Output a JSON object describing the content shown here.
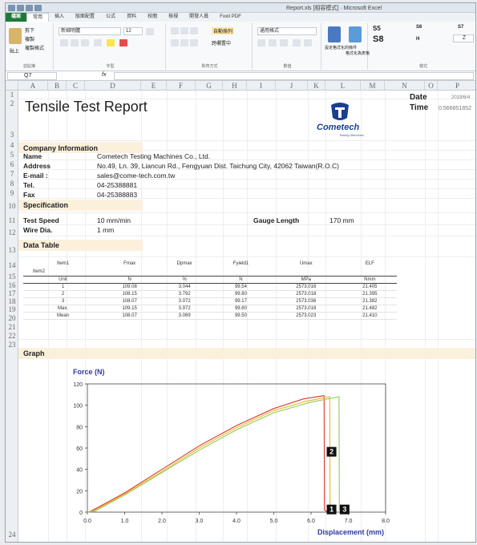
{
  "window": {
    "document_title": "Report.xls  [相容模式]  ·  Microsoft Excel"
  },
  "ribbon": {
    "tabs": [
      {
        "label": "檔案"
      },
      {
        "label": "常用"
      },
      {
        "label": "插入"
      },
      {
        "label": "版面配置"
      },
      {
        "label": "公式"
      },
      {
        "label": "資料"
      },
      {
        "label": "校閱"
      },
      {
        "label": "檢視"
      },
      {
        "label": "開發人員"
      },
      {
        "label": "Foxit PDF"
      }
    ],
    "clipboard": {
      "paste": "貼上",
      "cut": "剪下",
      "copy": "複製",
      "format_painter": "複製格式",
      "label": "剪貼簿"
    },
    "font": {
      "name": "新細明體",
      "size": "12",
      "label": "字型"
    },
    "alignment": {
      "wrap": "自動換列",
      "merge": "跨欄置中",
      "label": "對齊方式"
    },
    "number": {
      "format": "通用格式",
      "label": "數值"
    },
    "conditional": {
      "cond_fmt": "設定格式化的條件",
      "table_fmt": "格式化為表格"
    },
    "styles": {
      "s5": "S5",
      "s6": "S6",
      "s7": "S7",
      "s8": "S8",
      "label": "樣式"
    },
    "style_extra": {
      "h": "H",
      "z": "Z"
    }
  },
  "formula_bar": {
    "name_box": "Q7",
    "fx": "fx",
    "value": ""
  },
  "columns": [
    "A",
    "B",
    "C",
    "D",
    "E",
    "F",
    "G",
    "H",
    "I",
    "J",
    "K",
    "L",
    "M",
    "N",
    "O",
    "P"
  ],
  "rows": [
    "1",
    "2",
    "3",
    "4",
    "5",
    "6",
    "7",
    "8",
    "9",
    "10",
    "11",
    "12",
    "13",
    "14",
    "15",
    "16",
    "17",
    "18",
    "19",
    "20",
    "21",
    "22",
    "23",
    "24"
  ],
  "report": {
    "title": "Tensile Test Report",
    "date_label": "Date",
    "date_value": "2019/6/4",
    "time_label": "Time",
    "time_value": "0.566851852"
  },
  "logo": {
    "name": "Cometech",
    "tagline": "Testing Machines"
  },
  "company": {
    "heading": "Company Information",
    "fields": [
      {
        "label": "Name",
        "value": "Cometech Testing Machines Co., Ltd."
      },
      {
        "label": "Address",
        "value": "No.49, Ln. 39, Liancun Rd., Fengyuan Dist. Taichung City, 42062 Taiwan(R.O.C)"
      },
      {
        "label": "E-mail :",
        "value": "sales@come-tech.com.tw"
      },
      {
        "label": "Tel.",
        "value": "04-25388881"
      },
      {
        "label": "Fax",
        "value": "04-25388883"
      }
    ]
  },
  "specification": {
    "heading": "Specification",
    "test_speed_label": "Test Speed",
    "test_speed_value": "10 mm/min",
    "gauge_label": "Gauge Length",
    "gauge_value": "170 mm",
    "wire_label": "Wire Dia.",
    "wire_value": "1 mm"
  },
  "data_table": {
    "heading": "Data Table",
    "headers": [
      "Item1",
      "Fmax",
      "Dpmax",
      "Fyield1",
      "Umax",
      "ELF"
    ],
    "item2": "Item2",
    "units": [
      "Unit",
      "N",
      "%",
      "N",
      "MPa",
      "Nmm"
    ],
    "rows": [
      [
        "1",
        "109.08",
        "3.044",
        "99.54",
        "2573.016",
        "21.405"
      ],
      [
        "2",
        "108.15",
        "3.792",
        "99.80",
        "2573.018",
        "21.395"
      ],
      [
        "3",
        "108.07",
        "3.072",
        "99.17",
        "2573.036",
        "21.382"
      ],
      [
        "Max.",
        "109.15",
        "3.972",
        "99.80",
        "2573.018",
        "21.482"
      ],
      [
        "Mean",
        "108.07",
        "3.069",
        "99.50",
        "2573.023",
        "21.410"
      ]
    ]
  },
  "graph": {
    "heading": "Graph"
  },
  "chart_data": {
    "type": "line",
    "title": "",
    "xlabel": "Displacement (mm)",
    "ylabel": "Force (N)",
    "xlim": [
      0,
      8
    ],
    "ylim": [
      0,
      120
    ],
    "xticks": [
      "0.0",
      "1.0",
      "2.0",
      "3.0",
      "4.0",
      "5.0",
      "6.0",
      "7.0",
      "8.0"
    ],
    "yticks": [
      "0",
      "20",
      "40",
      "60",
      "80",
      "100",
      "120"
    ],
    "grid": false,
    "series": [
      {
        "color": "#d9362c",
        "x": [
          0,
          0.1,
          1.0,
          2.0,
          3.0,
          4.0,
          5.0,
          5.8,
          6.35,
          6.36,
          6.45
        ],
        "y": [
          0,
          1,
          18,
          40,
          62,
          81,
          97,
          106,
          109,
          2,
          0
        ]
      },
      {
        "color": "#e5b81e",
        "x": [
          0,
          0.15,
          1.0,
          2.0,
          3.0,
          4.0,
          5.0,
          5.9,
          6.5,
          6.51,
          6.6
        ],
        "y": [
          0,
          1,
          17,
          38,
          60,
          79,
          95,
          104,
          108,
          2,
          0
        ]
      },
      {
        "color": "#95c95a",
        "x": [
          0,
          0.2,
          1.0,
          2.0,
          3.0,
          4.0,
          5.0,
          6.0,
          6.75,
          6.76,
          6.85
        ],
        "y": [
          0,
          1,
          16,
          37,
          58,
          77,
          93,
          103,
          108,
          2,
          0
        ]
      }
    ],
    "annotations": [
      {
        "text": "2",
        "x": 6.55,
        "y": 52
      },
      {
        "text": "1",
        "x": 6.55,
        "y": -2
      },
      {
        "text": "3",
        "x": 6.9,
        "y": -2
      }
    ]
  }
}
